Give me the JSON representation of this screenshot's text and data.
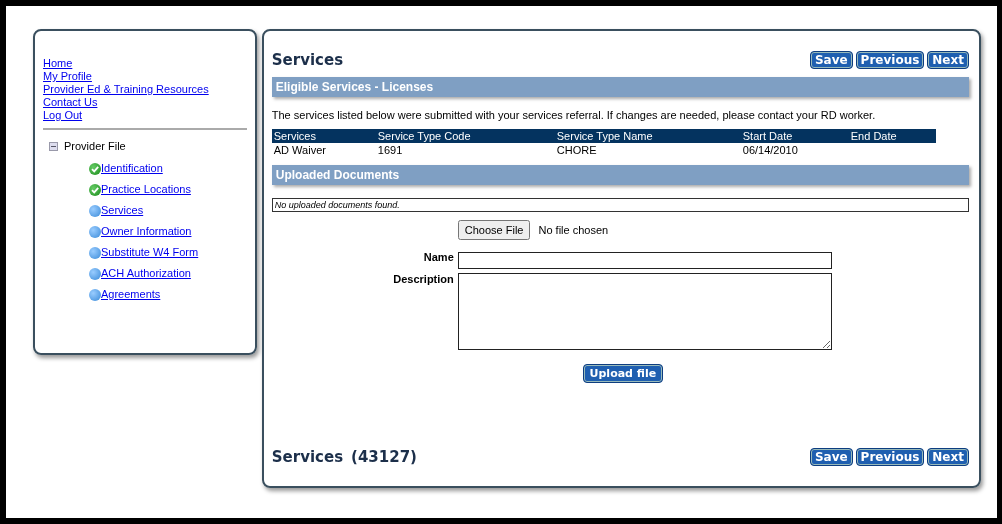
{
  "sidebar": {
    "links": [
      "Home",
      "My Profile",
      "Provider Ed & Training Resources",
      "Contact Us",
      "Log Out"
    ],
    "tree": {
      "label": "Provider File",
      "expanded": true,
      "children": [
        {
          "label": "Identification",
          "completed": true
        },
        {
          "label": "Practice Locations",
          "completed": true
        },
        {
          "label": "Services",
          "completed": false
        },
        {
          "label": "Owner Information",
          "completed": false
        },
        {
          "label": "Substitute W4 Form",
          "completed": false
        },
        {
          "label": "ACH Authorization",
          "completed": false
        },
        {
          "label": "Agreements",
          "completed": false
        }
      ]
    }
  },
  "main": {
    "title": "Services",
    "buttons": [
      "Save",
      "Previous",
      "Next"
    ],
    "eligible": {
      "heading": "Eligible Services - Licenses",
      "note": "The services listed below were submitted with your services referral. If changes are needed, please contact your RD worker.",
      "columns": [
        "Services",
        "Service Type Code",
        "Service Type Name",
        "Start Date",
        "End Date"
      ],
      "rows": [
        [
          "AD Waiver",
          "1691",
          "CHORE",
          "06/14/2010"
        ]
      ]
    },
    "uploads": {
      "heading": "Uploaded Documents",
      "empty": "No uploaded documents found.",
      "choose_button": "Choose File",
      "file_status": "No file chosen",
      "name_label": "Name",
      "description_label": "Description",
      "upload_button": "Upload file"
    },
    "footer": {
      "title": "Services",
      "id": "(43127)",
      "buttons": [
        "Save",
        "Previous",
        "Next"
      ]
    }
  }
}
